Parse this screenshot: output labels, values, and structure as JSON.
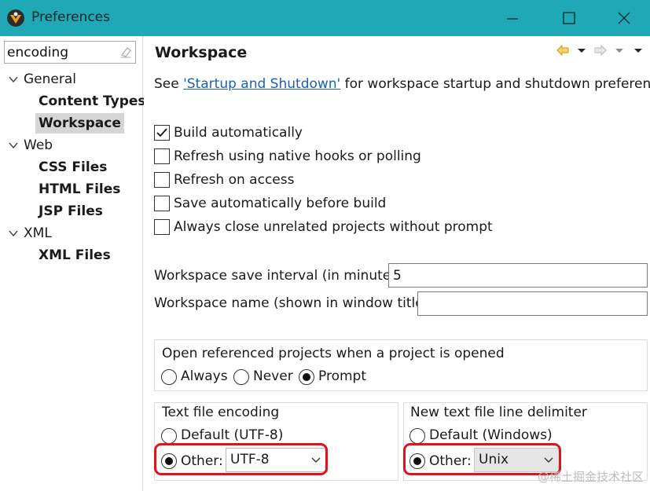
{
  "window": {
    "title": "Preferences"
  },
  "filter": {
    "value": "encoding"
  },
  "tree": {
    "general": "General",
    "content_types": "Content Types",
    "workspace": "Workspace",
    "web": "Web",
    "css_files": "CSS Files",
    "html_files": "HTML Files",
    "jsp_files": "JSP Files",
    "xml": "XML",
    "xml_files": "XML Files"
  },
  "page": {
    "title": "Workspace",
    "info_prefix": "See ",
    "info_link": "'Startup and Shutdown'",
    "info_suffix": " for workspace startup and shutdown preferences."
  },
  "checkboxes": [
    {
      "label": "Build automatically",
      "checked": true
    },
    {
      "label": "Refresh using native hooks or polling",
      "checked": false
    },
    {
      "label": "Refresh on access",
      "checked": false
    },
    {
      "label": "Save automatically before build",
      "checked": false
    },
    {
      "label": "Always close unrelated projects without prompt",
      "checked": false
    }
  ],
  "save_interval": {
    "label": "Workspace save interval (in minutes):",
    "value": "5"
  },
  "workspace_name": {
    "label": "Workspace name (shown in window title):",
    "value": ""
  },
  "open_projects": {
    "title": "Open referenced projects when a project is opened",
    "options": [
      "Always",
      "Never",
      "Prompt"
    ],
    "selected": "Prompt"
  },
  "encoding": {
    "title": "Text file encoding",
    "default_label": "Default (UTF-8)",
    "other_label": "Other:",
    "selected": "Other",
    "value": "UTF-8"
  },
  "delimiter": {
    "title": "New text file line delimiter",
    "default_label": "Default (Windows)",
    "other_label": "Other:",
    "selected": "Other",
    "value": "Unix"
  },
  "watermark": "@稀土掘金技术社区",
  "colors": {
    "titlebar": "#1fa9b6",
    "selection": "#d5d5d5",
    "link": "#1a5fb4",
    "highlight": "#e0131c"
  }
}
